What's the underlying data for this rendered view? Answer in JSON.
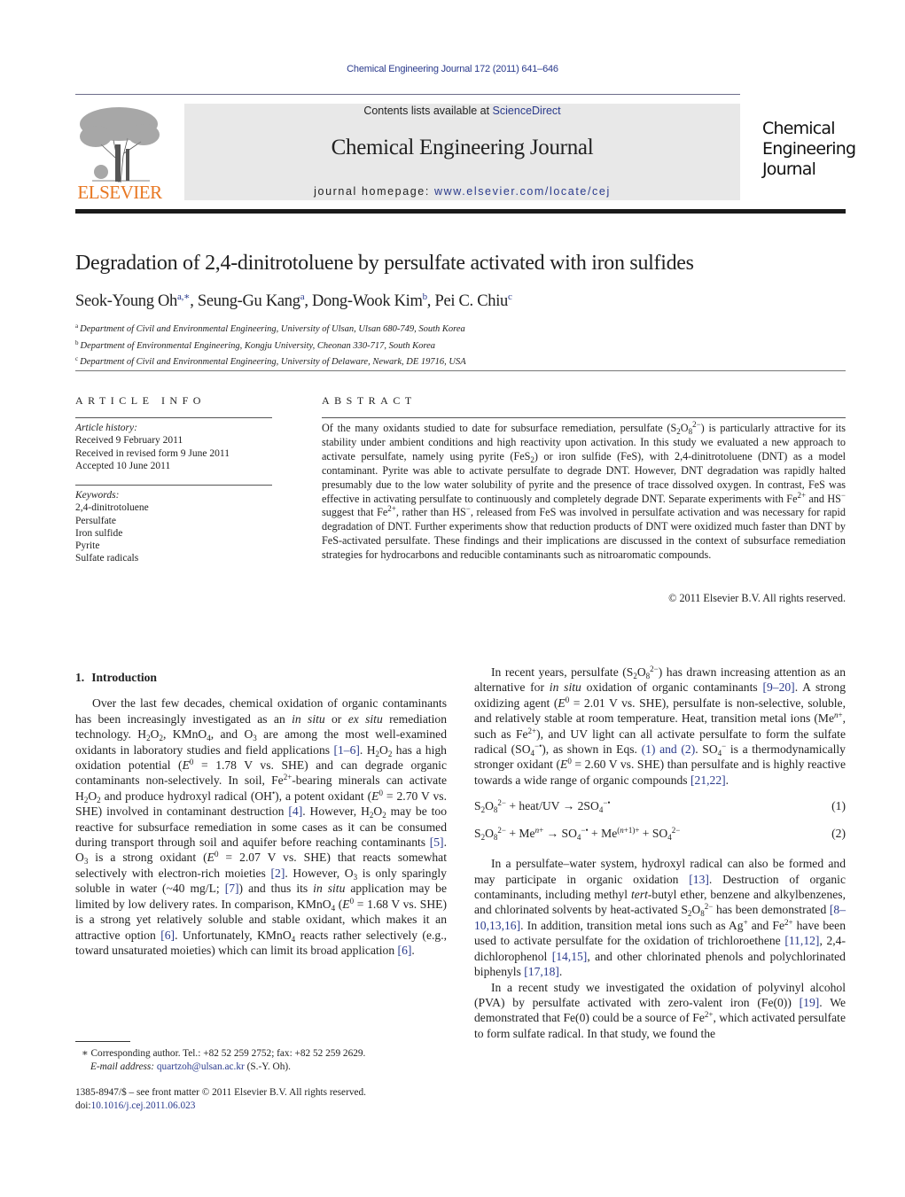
{
  "header": {
    "citation": "Chemical Engineering Journal 172 (2011) 641–646",
    "contents_prefix": "Contents lists available at ",
    "contents_link": "ScienceDirect",
    "journal_name": "Chemical Engineering Journal",
    "homepage_prefix": "journal homepage: ",
    "homepage_url": "www.elsevier.com/locate/cej",
    "publisher_logo": "ELSEVIER",
    "cover_lines": [
      "Chemical",
      "Engineering",
      "Journal"
    ],
    "colors": {
      "link": "#2a3a8c",
      "elsevier_orange": "#e87722",
      "banner_bg": "#e8e8e8"
    }
  },
  "article": {
    "title": "Degradation of 2,4-dinitrotoluene by persulfate activated with iron sulfides",
    "authors": [
      {
        "name": "Seok-Young Oh",
        "marks": "a,∗"
      },
      {
        "name": "Seung-Gu Kang",
        "marks": "a"
      },
      {
        "name": "Dong-Wook Kim",
        "marks": "b"
      },
      {
        "name": "Pei C. Chiu",
        "marks": "c"
      }
    ],
    "affiliations": [
      {
        "mark": "a",
        "text": "Department of Civil and Environmental Engineering, University of Ulsan, Ulsan 680-749, South Korea"
      },
      {
        "mark": "b",
        "text": "Department of Environmental Engineering, Kongju University, Cheonan 330-717, South Korea"
      },
      {
        "mark": "c",
        "text": "Department of Civil and Environmental Engineering, University of Delaware, Newark, DE 19716, USA"
      }
    ]
  },
  "article_info": {
    "label": "ARTICLE INFO",
    "history_label": "Article history:",
    "history": [
      "Received 9 February 2011",
      "Received in revised form 9 June 2011",
      "Accepted 10 June 2011"
    ],
    "keywords_label": "Keywords:",
    "keywords": [
      "2,4-dinitrotoluene",
      "Persulfate",
      "Iron sulfide",
      "Pyrite",
      "Sulfate radicals"
    ]
  },
  "abstract": {
    "label": "ABSTRACT",
    "s1a": "Of the many oxidants studied to date for subsurface remediation, persulfate (S",
    "s1b": ") is particularly attractive for its stability under ambient conditions and high reactivity upon activation. In this study we evaluated a new approach to activate persulfate, namely using pyrite (FeS",
    "s1c": ") or iron sulfide (FeS), with 2,4-dinitrotoluene (DNT) as a model contaminant. Pyrite was able to activate persulfate to degrade DNT. However, DNT degradation was rapidly halted presumably due to the low water solubility of pyrite and the presence of trace dissolved oxygen. In contrast, FeS was effective in activating persulfate to continuously and completely degrade DNT. Separate experiments with Fe",
    "s1d": " and HS",
    "s1e": " suggest that Fe",
    "s1f": ", rather than HS",
    "s1g": ", released from FeS was involved in persulfate activation and was necessary for rapid degradation of DNT. Further experiments show that reduction products of DNT were oxidized much faster than DNT by FeS-activated persulfate. These findings and their implications are discussed in the context of subsurface remediation strategies for hydrocarbons and reducible contaminants such as nitroaromatic compounds.",
    "copyright": "© 2011 Elsevier B.V. All rights reserved."
  },
  "introduction": {
    "number": "1.",
    "heading": "Introduction",
    "p1": {
      "a": "Over the last few decades, chemical oxidation of organic contaminants has been increasingly investigated as an ",
      "in_situ": "in situ",
      "or": " or ",
      "ex_situ": "ex situ",
      "b": " remediation technology. H",
      "c": "O",
      "d": ", KMnO",
      "e": ", and O",
      "f": " are among the most well-examined oxidants in laboratory studies and field applications ",
      "ref1": "[1–6]",
      "g": ". H",
      "h": "O",
      "i": " has a high oxidation potential (",
      "j": " = 1.78 V vs. SHE) and can degrade organic contaminants non-selectively. In soil, Fe",
      "k": "-bearing minerals can activate H",
      "l": "O",
      "m": " and produce hydroxyl radical (OH",
      "n": "), a potent oxidant (",
      "o": " = 2.70 V vs. SHE) involved in contaminant destruction ",
      "ref2": "[4]",
      "p": ". However, H",
      "q": "O",
      "r": " may be too reactive for subsurface remediation in some cases as it can be consumed during transport through soil and aquifer before reaching contaminants ",
      "ref3": "[5]",
      "s": ". O",
      "t": " is a strong oxidant (",
      "u": " = 2.07 V vs. SHE) that reacts somewhat selectively with electron-rich moieties ",
      "ref4": "[2]",
      "v": ". However, O",
      "w": " is only sparingly soluble in water (~40 mg/L; ",
      "ref5": "[7]",
      "x": ") and thus its ",
      "y": " application may be limited by low delivery rates. In comparison, KMnO",
      "z": " (",
      "aa": " = 1.68 V vs. SHE) is a strong yet relatively soluble and stable oxidant, which makes it an attractive option ",
      "ref6": "[6]",
      "bb": ". Unfortunately, KMnO",
      "cc": " reacts rather selectively (e.g., toward unsaturated moieties) which can limit its broad application ",
      "ref7": "[6]",
      "dd": "."
    },
    "p2": {
      "a": "In recent years, persulfate (S",
      "b": ") has drawn increasing attention as an alternative for ",
      "in_situ": "in situ",
      "c": " oxidation of organic contaminants ",
      "ref1": "[9–20]",
      "d": ". A strong oxidizing agent (",
      "e": " = 2.01 V vs. SHE), persulfate is non-selective, soluble, and relatively stable at room temperature. Heat, transition metal ions (Me",
      "f": ", such as Fe",
      "g": "), and UV light can all activate persulfate to form the sulfate radical (SO",
      "h": "), as shown in Eqs. ",
      "ref2": "(1) and (2)",
      "i": ". SO",
      "j": " is a thermodynamically stronger oxidant (",
      "k": " = 2.60 V vs. SHE) than persulfate and is highly reactive towards a wide range of organic compounds ",
      "ref3": "[21,22]",
      "l": "."
    },
    "equations": [
      {
        "lhs_a": "S",
        "rhs": " + heat/UV  →  2SO",
        "number": "(1)"
      },
      {
        "lhs_a": "S",
        "rhs": " + Me",
        "number": "(2)"
      }
    ],
    "p3": {
      "a": "In a persulfate–water system, hydroxyl radical can also be formed and may participate in organic oxidation ",
      "ref1": "[13]",
      "b": ". Destruction of organic contaminants, including methyl ",
      "tert": "tert",
      "c": "-butyl ether, benzene and alkylbenzenes, and chlorinated solvents by heat-activated S",
      "d": " has been demonstrated ",
      "ref2": "[8–10,13,16]",
      "e": ". In addition, transition metal ions such as Ag",
      "f": " and Fe",
      "g": " have been used to activate persulfate for the oxidation of trichloroethene ",
      "ref3": "[11,12]",
      "h": ", 2,4-dichlorophenol ",
      "ref4": "[14,15]",
      "i": ", and other chlorinated phenols and polychlorinated biphenyls ",
      "ref5": "[17,18]",
      "j": "."
    },
    "p4": {
      "a": "In a recent study we investigated the oxidation of polyvinyl alcohol (PVA) by persulfate activated with zero-valent iron (Fe(0)) ",
      "ref1": "[19]",
      "b": ". We demonstrated that Fe(0) could be a source of Fe",
      "c": ", which activated persulfate to form sulfate radical. In that study, we found the"
    }
  },
  "footnotes": {
    "star": "∗",
    "corresponding": " Corresponding author. Tel.: +82 52 259 2752; fax: +82 52 259 2629.",
    "email_label": "E-mail address: ",
    "email": "quartzoh@ulsan.ac.kr",
    "email_suffix": " (S.-Y. Oh).",
    "front_matter": "1385-8947/$ – see front matter © 2011 Elsevier B.V. All rights reserved.",
    "doi_prefix": "doi:",
    "doi": "10.1016/j.cej.2011.06.023"
  }
}
